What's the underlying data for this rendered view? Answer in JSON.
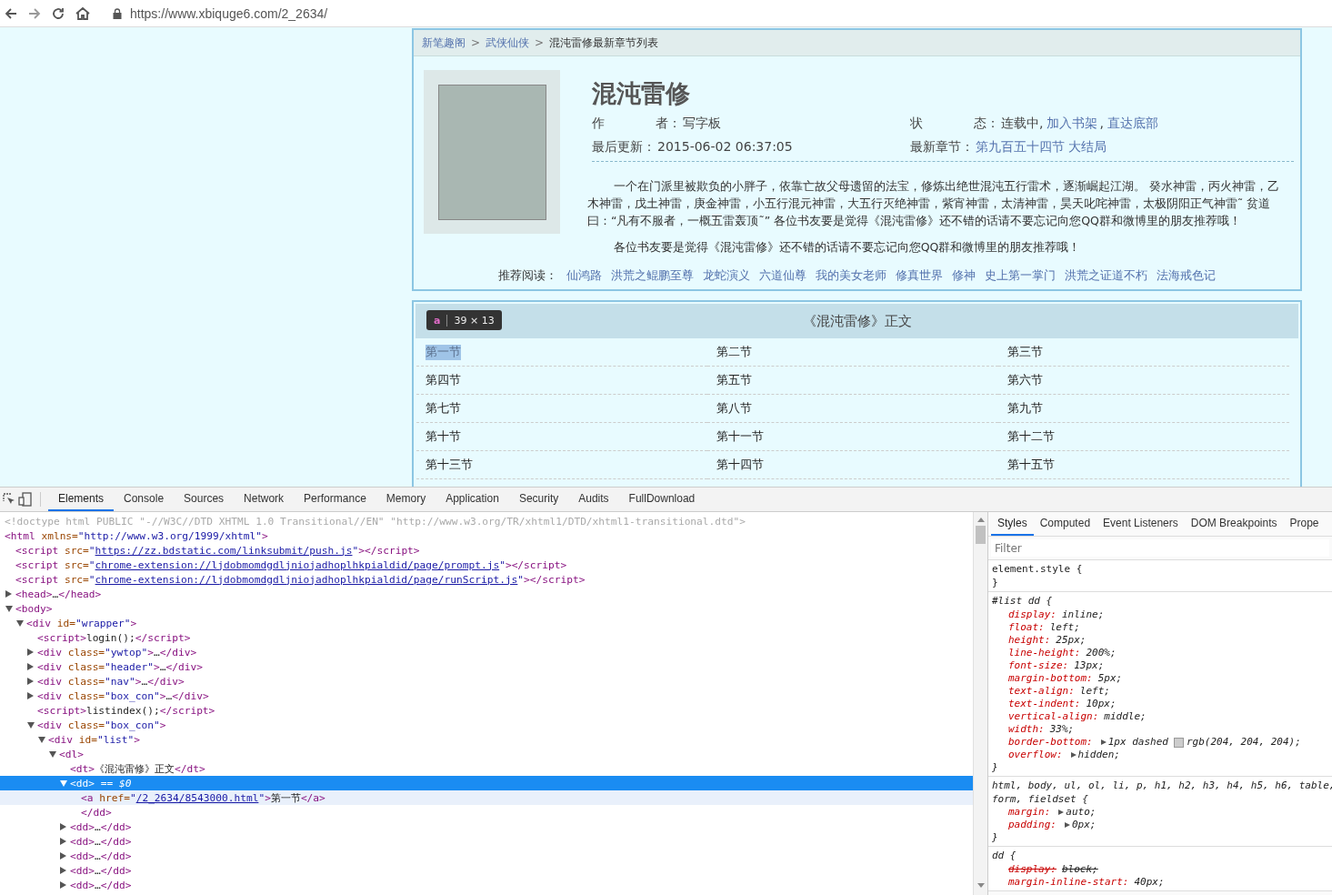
{
  "browser": {
    "url": "https://www.xbiquge6.com/2_2634/"
  },
  "breadcrumb": {
    "links": [
      "新笔趣阁",
      "武侠仙侠"
    ],
    "separator": ">",
    "current": "混沌雷修最新章节列表"
  },
  "book": {
    "title": "混沌雷修",
    "meta": [
      {
        "label": "作　　　　者：",
        "text": "写字板"
      },
      {
        "label": "状　　　　态：",
        "text": "连载中,",
        "links": [
          "加入书架",
          "直达底部"
        ],
        "separator": ","
      },
      {
        "label": "最后更新：",
        "text": "2015-06-02 06:37:05"
      },
      {
        "label": "最新章节：",
        "links": [
          "第九百五十四节 大结局"
        ]
      }
    ],
    "intro": [
      "一个在门派里被欺负的小胖子，依靠亡故父母遗留的法宝，修炼出绝世混沌五行雷术，逐渐崛起江湖。 癸水神雷，丙火神雷，乙木神雷，戊土神雷，庚金神雷，小五行混元神雷，大五行灭绝神雷，紫宵神雷，太清神雷，昊天叱咤神雷，太极阴阳正气神雷˜ 贫道曰：“凡有不服者，一概五雷轰顶˜” 各位书友要是觉得《混沌雷修》还不错的话请不要忘记向您QQ群和微博里的朋友推荐哦！",
      "各位书友要是觉得《混沌雷修》还不错的话请不要忘记向您QQ群和微博里的朋友推荐哦！"
    ]
  },
  "recommend": {
    "label": "推荐阅读：",
    "links": [
      "仙鸿路",
      "洪荒之鲲鹏至尊",
      "龙蛇演义",
      "六道仙尊",
      "我的美女老师",
      "修真世界",
      "修神",
      "史上第一掌门",
      "洪荒之证道不朽",
      "法海戒色记"
    ]
  },
  "chapter_list": {
    "title": "《混沌雷修》正文",
    "tooltip": {
      "tag": "a",
      "size": "39 × 13"
    },
    "chapters": [
      {
        "title": "第一节",
        "highlighted": true
      },
      {
        "title": "第二节",
        "highlighted": false
      },
      {
        "title": "第三节",
        "highlighted": false
      },
      {
        "title": "第四节",
        "highlighted": false
      },
      {
        "title": "第五节",
        "highlighted": false
      },
      {
        "title": "第六节",
        "highlighted": false
      },
      {
        "title": "第七节",
        "highlighted": false
      },
      {
        "title": "第八节",
        "highlighted": false
      },
      {
        "title": "第九节",
        "highlighted": false
      },
      {
        "title": "第十节",
        "highlighted": false
      },
      {
        "title": "第十一节",
        "highlighted": false
      },
      {
        "title": "第十二节",
        "highlighted": false
      },
      {
        "title": "第十三节",
        "highlighted": false
      },
      {
        "title": "第十四节",
        "highlighted": false
      },
      {
        "title": "第十五节",
        "highlighted": false
      }
    ]
  },
  "devtools": {
    "tabs": [
      {
        "label": "Elements",
        "selected": true
      },
      {
        "label": "Console",
        "selected": false
      },
      {
        "label": "Sources",
        "selected": false
      },
      {
        "label": "Network",
        "selected": false
      },
      {
        "label": "Performance",
        "selected": false
      },
      {
        "label": "Memory",
        "selected": false
      },
      {
        "label": "Application",
        "selected": false
      },
      {
        "label": "Security",
        "selected": false
      },
      {
        "label": "Audits",
        "selected": false
      },
      {
        "label": "FullDownload",
        "selected": false
      }
    ],
    "dom": [
      {
        "selected": false,
        "hovered": false,
        "parts": [
          {
            "kind": "comment",
            "text": "<!doctype html PUBLIC \"-//W3C//DTD XHTML 1.0 Transitional//EN\" \"http://www.w3.org/TR/xhtml1/DTD/xhtml1-transitional.dtd\">"
          }
        ]
      },
      {
        "selected": false,
        "hovered": false,
        "parts": [
          {
            "kind": "tag",
            "text": "<html "
          },
          {
            "kind": "attr",
            "text": "xmlns="
          },
          {
            "kind": "value",
            "text": "\"http://www.w3.org/1999/xhtml\""
          },
          {
            "kind": "tag",
            "text": ">"
          }
        ],
        "children": [
          {
            "selected": false,
            "hovered": false,
            "parts": [
              {
                "kind": "tag",
                "text": "<script "
              },
              {
                "kind": "attr",
                "text": "src="
              },
              {
                "kind": "value",
                "text": "\""
              },
              {
                "kind": "link",
                "text": "https://zz.bdstatic.com/linksubmit/push.js"
              },
              {
                "kind": "value",
                "text": "\""
              },
              {
                "kind": "tag",
                "text": "></script>"
              }
            ]
          },
          {
            "selected": false,
            "hovered": false,
            "parts": [
              {
                "kind": "tag",
                "text": "<script "
              },
              {
                "kind": "attr",
                "text": "src="
              },
              {
                "kind": "value",
                "text": "\""
              },
              {
                "kind": "link",
                "text": "chrome-extension://ljdobmomdgdljniojadhoplhkpialdid/page/prompt.js"
              },
              {
                "kind": "value",
                "text": "\""
              },
              {
                "kind": "tag",
                "text": "></script>"
              }
            ]
          },
          {
            "selected": false,
            "hovered": false,
            "parts": [
              {
                "kind": "tag",
                "text": "<script "
              },
              {
                "kind": "attr",
                "text": "src="
              },
              {
                "kind": "value",
                "text": "\""
              },
              {
                "kind": "link",
                "text": "chrome-extension://ljdobmomdgdljniojadhoplhkpialdid/page/runScript.js"
              },
              {
                "kind": "value",
                "text": "\""
              },
              {
                "kind": "tag",
                "text": "></script>"
              }
            ]
          },
          {
            "expanded": false,
            "selected": false,
            "hovered": false,
            "parts": [
              {
                "kind": "tag",
                "text": "<head>"
              },
              {
                "kind": "text",
                "text": "…"
              },
              {
                "kind": "tag",
                "text": "</head>"
              }
            ]
          },
          {
            "expanded": true,
            "selected": false,
            "hovered": false,
            "parts": [
              {
                "kind": "tag",
                "text": "<body>"
              }
            ],
            "children": [
              {
                "expanded": true,
                "selected": false,
                "hovered": false,
                "parts": [
                  {
                    "kind": "tag",
                    "text": "<div "
                  },
                  {
                    "kind": "attr",
                    "text": "id="
                  },
                  {
                    "kind": "value",
                    "text": "\"wrapper\""
                  },
                  {
                    "kind": "tag",
                    "text": ">"
                  }
                ],
                "children": [
                  {
                    "selected": false,
                    "hovered": false,
                    "parts": [
                      {
                        "kind": "tag",
                        "text": "<script>"
                      },
                      {
                        "kind": "text",
                        "text": "login();"
                      },
                      {
                        "kind": "tag",
                        "text": "</script>"
                      }
                    ]
                  },
                  {
                    "expanded": false,
                    "selected": false,
                    "hovered": false,
                    "parts": [
                      {
                        "kind": "tag",
                        "text": "<div "
                      },
                      {
                        "kind": "attr",
                        "text": "class="
                      },
                      {
                        "kind": "value",
                        "text": "\"ywtop\""
                      },
                      {
                        "kind": "tag",
                        "text": ">"
                      },
                      {
                        "kind": "text",
                        "text": "…"
                      },
                      {
                        "kind": "tag",
                        "text": "</div>"
                      }
                    ]
                  },
                  {
                    "expanded": false,
                    "selected": false,
                    "hovered": false,
                    "parts": [
                      {
                        "kind": "tag",
                        "text": "<div "
                      },
                      {
                        "kind": "attr",
                        "text": "class="
                      },
                      {
                        "kind": "value",
                        "text": "\"header\""
                      },
                      {
                        "kind": "tag",
                        "text": ">"
                      },
                      {
                        "kind": "text",
                        "text": "…"
                      },
                      {
                        "kind": "tag",
                        "text": "</div>"
                      }
                    ]
                  },
                  {
                    "expanded": false,
                    "selected": false,
                    "hovered": false,
                    "parts": [
                      {
                        "kind": "tag",
                        "text": "<div "
                      },
                      {
                        "kind": "attr",
                        "text": "class="
                      },
                      {
                        "kind": "value",
                        "text": "\"nav\""
                      },
                      {
                        "kind": "tag",
                        "text": ">"
                      },
                      {
                        "kind": "text",
                        "text": "…"
                      },
                      {
                        "kind": "tag",
                        "text": "</div>"
                      }
                    ]
                  },
                  {
                    "expanded": false,
                    "selected": false,
                    "hovered": false,
                    "parts": [
                      {
                        "kind": "tag",
                        "text": "<div "
                      },
                      {
                        "kind": "attr",
                        "text": "class="
                      },
                      {
                        "kind": "value",
                        "text": "\"box_con\""
                      },
                      {
                        "kind": "tag",
                        "text": ">"
                      },
                      {
                        "kind": "text",
                        "text": "…"
                      },
                      {
                        "kind": "tag",
                        "text": "</div>"
                      }
                    ]
                  },
                  {
                    "selected": false,
                    "hovered": false,
                    "parts": [
                      {
                        "kind": "tag",
                        "text": "<script>"
                      },
                      {
                        "kind": "text",
                        "text": "listindex();"
                      },
                      {
                        "kind": "tag",
                        "text": "</script>"
                      }
                    ]
                  },
                  {
                    "expanded": true,
                    "selected": false,
                    "hovered": false,
                    "parts": [
                      {
                        "kind": "tag",
                        "text": "<div "
                      },
                      {
                        "kind": "attr",
                        "text": "class="
                      },
                      {
                        "kind": "value",
                        "text": "\"box_con\""
                      },
                      {
                        "kind": "tag",
                        "text": ">"
                      }
                    ],
                    "children": [
                      {
                        "expanded": true,
                        "selected": false,
                        "hovered": false,
                        "parts": [
                          {
                            "kind": "tag",
                            "text": "<div "
                          },
                          {
                            "kind": "attr",
                            "text": "id="
                          },
                          {
                            "kind": "value",
                            "text": "\"list\""
                          },
                          {
                            "kind": "tag",
                            "text": ">"
                          }
                        ],
                        "children": [
                          {
                            "expanded": true,
                            "selected": false,
                            "hovered": false,
                            "parts": [
                              {
                                "kind": "tag",
                                "text": "<dl>"
                              }
                            ],
                            "children": [
                              {
                                "selected": false,
                                "hovered": false,
                                "parts": [
                                  {
                                    "kind": "tag",
                                    "text": "<dt>"
                                  },
                                  {
                                    "kind": "text",
                                    "text": "《混沌雷修》正文"
                                  },
                                  {
                                    "kind": "tag",
                                    "text": "</dt>"
                                  }
                                ]
                              },
                              {
                                "expanded": true,
                                "selected": true,
                                "hovered": false,
                                "parts": [
                                  {
                                    "kind": "tag",
                                    "text": "<dd>"
                                  },
                                  {
                                    "kind": "eq",
                                    "text": " == $0"
                                  }
                                ],
                                "children": [
                                  {
                                    "selected": false,
                                    "hovered": true,
                                    "parts": [
                                      {
                                        "kind": "tag",
                                        "text": "<a "
                                      },
                                      {
                                        "kind": "attr",
                                        "text": "href="
                                      },
                                      {
                                        "kind": "value",
                                        "text": "\""
                                      },
                                      {
                                        "kind": "link",
                                        "text": "/2_2634/8543000.html"
                                      },
                                      {
                                        "kind": "value",
                                        "text": "\""
                                      },
                                      {
                                        "kind": "tag",
                                        "text": ">"
                                      },
                                      {
                                        "kind": "text",
                                        "text": "第一节"
                                      },
                                      {
                                        "kind": "tag",
                                        "text": "</a>"
                                      }
                                    ]
                                  },
                                  {
                                    "selected": false,
                                    "hovered": false,
                                    "parts": [
                                      {
                                        "kind": "tag",
                                        "text": "</dd>"
                                      }
                                    ]
                                  }
                                ]
                              },
                              {
                                "expanded": false,
                                "selected": false,
                                "hovered": false,
                                "parts": [
                                  {
                                    "kind": "tag",
                                    "text": "<dd>"
                                  },
                                  {
                                    "kind": "text",
                                    "text": "…"
                                  },
                                  {
                                    "kind": "tag",
                                    "text": "</dd>"
                                  }
                                ]
                              },
                              {
                                "expanded": false,
                                "selected": false,
                                "hovered": false,
                                "parts": [
                                  {
                                    "kind": "tag",
                                    "text": "<dd>"
                                  },
                                  {
                                    "kind": "text",
                                    "text": "…"
                                  },
                                  {
                                    "kind": "tag",
                                    "text": "</dd>"
                                  }
                                ]
                              },
                              {
                                "expanded": false,
                                "selected": false,
                                "hovered": false,
                                "parts": [
                                  {
                                    "kind": "tag",
                                    "text": "<dd>"
                                  },
                                  {
                                    "kind": "text",
                                    "text": "…"
                                  },
                                  {
                                    "kind": "tag",
                                    "text": "</dd>"
                                  }
                                ]
                              },
                              {
                                "expanded": false,
                                "selected": false,
                                "hovered": false,
                                "parts": [
                                  {
                                    "kind": "tag",
                                    "text": "<dd>"
                                  },
                                  {
                                    "kind": "text",
                                    "text": "…"
                                  },
                                  {
                                    "kind": "tag",
                                    "text": "</dd>"
                                  }
                                ]
                              },
                              {
                                "expanded": false,
                                "selected": false,
                                "hovered": false,
                                "parts": [
                                  {
                                    "kind": "tag",
                                    "text": "<dd>"
                                  },
                                  {
                                    "kind": "text",
                                    "text": "…"
                                  },
                                  {
                                    "kind": "tag",
                                    "text": "</dd>"
                                  }
                                ]
                              }
                            ]
                          }
                        ]
                      }
                    ]
                  }
                ]
              }
            ]
          }
        ]
      }
    ],
    "styles": {
      "tabs": [
        {
          "label": "Styles",
          "selected": true
        },
        {
          "label": "Computed",
          "selected": false
        },
        {
          "label": "Event Listeners",
          "selected": false
        },
        {
          "label": "DOM Breakpoints",
          "selected": false
        },
        {
          "label": "Prope",
          "selected": false
        }
      ],
      "filter": {
        "placeholder": "Filter"
      },
      "rules": [
        {
          "kind": "inline",
          "selector": [
            "element.style {"
          ],
          "close": "}"
        },
        {
          "kind": "author",
          "selector": [
            "#list dd {"
          ],
          "props": [
            {
              "name": "display:",
              "value": "inline;",
              "expandable": false,
              "struck": false
            },
            {
              "name": "float:",
              "value": "left;",
              "expandable": false,
              "struck": false
            },
            {
              "name": "height:",
              "value": "25px;",
              "expandable": false,
              "struck": false
            },
            {
              "name": "line-height:",
              "value": "200%;",
              "expandable": false,
              "struck": false
            },
            {
              "name": "font-size:",
              "value": "13px;",
              "expandable": false,
              "struck": false
            },
            {
              "name": "margin-bottom:",
              "value": "5px;",
              "expandable": false,
              "struck": false
            },
            {
              "name": "text-align:",
              "value": "left;",
              "expandable": false,
              "struck": false
            },
            {
              "name": "text-indent:",
              "value": "10px;",
              "expandable": false,
              "struck": false
            },
            {
              "name": "vertical-align:",
              "value": "middle;",
              "expandable": false,
              "struck": false
            },
            {
              "name": "width:",
              "value": "33%;",
              "expandable": false,
              "struck": false
            },
            {
              "name": "border-bottom:",
              "value": "1px dashed",
              "expandable": true,
              "struck": false,
              "color": "#cccccc",
              "after": "rgb(204, 204, 204);"
            },
            {
              "name": "overflow:",
              "value": "hidden;",
              "expandable": true,
              "struck": false
            }
          ],
          "close": "}"
        },
        {
          "kind": "author",
          "selector": [
            "html, body, ul, ol, li, p, h1, h2, h3, h4, h5, h6, table,",
            "form, fieldset {"
          ],
          "props": [
            {
              "name": "margin:",
              "value": "auto;",
              "expandable": true,
              "struck": false
            },
            {
              "name": "padding:",
              "value": "0px;",
              "expandable": true,
              "struck": false
            }
          ],
          "close": "}"
        },
        {
          "kind": "author",
          "selector": [
            "dd {"
          ],
          "props": [
            {
              "name": "display:",
              "value": "block;",
              "expandable": false,
              "struck": true
            },
            {
              "name": "margin-inline-start:",
              "value": "40px;",
              "expandable": false,
              "struck": false
            }
          ]
        }
      ]
    }
  }
}
